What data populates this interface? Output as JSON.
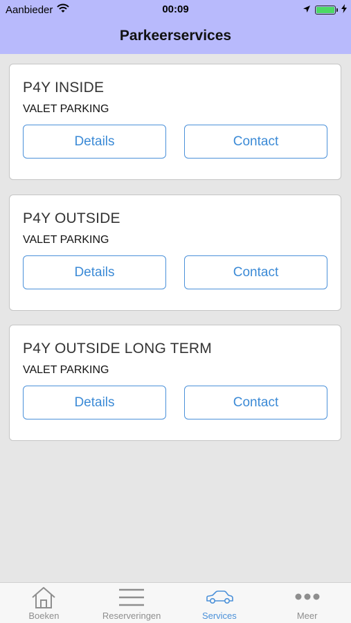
{
  "status_bar": {
    "carrier": "Aanbieder",
    "time": "00:09"
  },
  "header": {
    "title": "Parkeerservices"
  },
  "services": [
    {
      "title": "P4Y INSIDE",
      "subtitle": "VALET PARKING",
      "details_label": "Details",
      "contact_label": "Contact"
    },
    {
      "title": "P4Y OUTSIDE",
      "subtitle": "VALET PARKING",
      "details_label": "Details",
      "contact_label": "Contact"
    },
    {
      "title": "P4Y OUTSIDE LONG TERM",
      "subtitle": "VALET PARKING",
      "details_label": "Details",
      "contact_label": "Contact"
    }
  ],
  "tab_bar": {
    "items": [
      {
        "label": "Boeken",
        "icon": "home-icon"
      },
      {
        "label": "Reserveringen",
        "icon": "list-icon"
      },
      {
        "label": "Services",
        "icon": "car-icon",
        "active": true
      },
      {
        "label": "Meer",
        "icon": "more-icon"
      }
    ]
  },
  "colors": {
    "header_bg": "#b8bafc",
    "accent": "#4a90d9",
    "battery": "#4cd964",
    "background": "#e6e6e6"
  }
}
